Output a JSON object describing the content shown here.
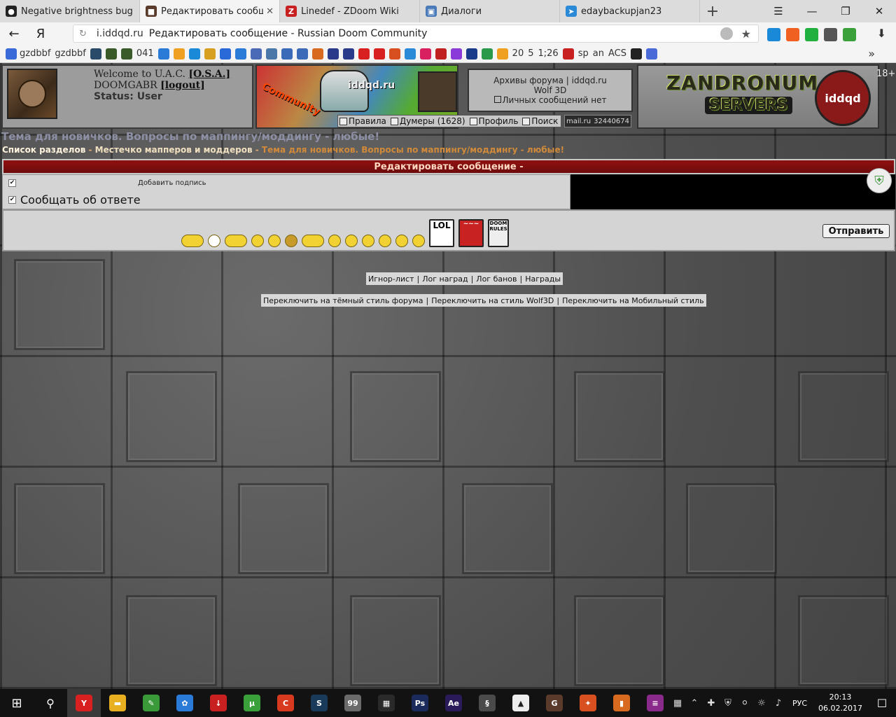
{
  "browser": {
    "tabs": [
      {
        "label": "Negative brightness bug (UD",
        "icon": "github-icon",
        "color": "#222222",
        "glyph": "●",
        "active": false,
        "close": ""
      },
      {
        "label": "Редактировать сообщение",
        "icon": "iddqd-icon",
        "color": "#5a3a2a",
        "glyph": "■",
        "active": true,
        "close": "✕"
      },
      {
        "label": "Linedef - ZDoom Wiki",
        "icon": "zdoom-icon",
        "color": "#c82020",
        "glyph": "Z",
        "active": false,
        "close": ""
      },
      {
        "label": "Диалоги",
        "icon": "messages-icon",
        "color": "#4a7ab8",
        "glyph": "▣",
        "active": false,
        "close": ""
      },
      {
        "label": "edaybackupjan23",
        "icon": "telegram-icon",
        "color": "#2a8ad8",
        "glyph": "➤",
        "active": false,
        "close": ""
      }
    ],
    "new_tab": "+",
    "window_controls": {
      "menu": "☰",
      "minimize": "—",
      "maximize": "❐",
      "close": "✕"
    },
    "back": "←",
    "yandex": "Я",
    "reload": "↻",
    "url_domain": "i.iddqd.ru",
    "url_title": "Редактировать сообщение - Russian Doom Community",
    "star": "★",
    "ext_colors": [
      "#1a8ad8",
      "#f06020",
      "#20b040",
      "#555555",
      "#3aa03a"
    ],
    "download": "⬇",
    "bookmarks": [
      {
        "label": "gzdbbf",
        "color": "#3a6ad8"
      },
      {
        "label": "gzdbbf",
        "color": ""
      },
      {
        "label": "",
        "color": "#2a4a6a"
      },
      {
        "label": "",
        "color": "#3a5a2a"
      },
      {
        "label": "",
        "color": "#3a5a2a"
      },
      {
        "label": "041",
        "color": ""
      },
      {
        "label": "",
        "color": "#2a7ad8"
      },
      {
        "label": "",
        "color": "#f0a020"
      },
      {
        "label": "",
        "color": "#1a8ad8"
      },
      {
        "label": "",
        "color": "#d8a020"
      },
      {
        "label": "",
        "color": "#2a6ad8"
      },
      {
        "label": "",
        "color": "#2a7ad8"
      },
      {
        "label": "",
        "color": "#4a6ab8"
      },
      {
        "label": "",
        "color": "#4a76a8"
      },
      {
        "label": "",
        "color": "#3a6ab8"
      },
      {
        "label": "",
        "color": "#3a6ab8"
      },
      {
        "label": "",
        "color": "#d86a20"
      },
      {
        "label": "",
        "color": "#2a3a8a"
      },
      {
        "label": "",
        "color": "#2a3a8a"
      },
      {
        "label": "",
        "color": "#d82020"
      },
      {
        "label": "",
        "color": "#d82020"
      },
      {
        "label": "",
        "color": "#d85020"
      },
      {
        "label": "",
        "color": "#2a8ad8"
      },
      {
        "label": "",
        "color": "#d82060"
      },
      {
        "label": "",
        "color": "#c02020"
      },
      {
        "label": "",
        "color": "#8a3ad8"
      },
      {
        "label": "",
        "color": "#1a3a8a"
      },
      {
        "label": "",
        "color": "#2a9a4a"
      },
      {
        "label": "",
        "color": "#f0a020"
      },
      {
        "label": "20",
        "color": ""
      },
      {
        "label": "5",
        "color": ""
      },
      {
        "label": "1;26",
        "color": ""
      },
      {
        "label": "",
        "color": "#c82020"
      },
      {
        "label": "sp",
        "color": ""
      },
      {
        "label": "an",
        "color": ""
      },
      {
        "label": "ACS",
        "color": ""
      },
      {
        "label": "",
        "color": "#222222"
      },
      {
        "label": "",
        "color": "#4a6ad8"
      }
    ],
    "bookmarks_more": "»"
  },
  "forum": {
    "welcome": "Welcome to U.A.C.",
    "osa": "[O.S.A.]",
    "username": "DOOMGABR",
    "logout": "[logout]",
    "status": "Status: User",
    "banner_community": "Community",
    "banner_site": "iddqd.ru",
    "nav": [
      {
        "label": "Правила",
        "icon": "rules-icon"
      },
      {
        "label": "Думеры (1628)",
        "icon": "users-icon"
      },
      {
        "label": "Профиль",
        "icon": "profile-icon"
      },
      {
        "label": "Поиск",
        "icon": "search-icon"
      }
    ],
    "archive_line1": "Архивы форума | iddqd.ru",
    "archive_line2": "Wolf 3D",
    "private_msgs": "Личных сообщений нет",
    "counter_left": "mail.ru",
    "counter_right": "32440674",
    "zand_title": "ZANDRONUM",
    "zand_servers": "SERVERS",
    "zand_badge": "iddqd",
    "age": "18+",
    "topic_title": "Тема для новичков. Вопросы по маппингу/моддингу - любые!",
    "breadcrumb": {
      "root": "Список разделов",
      "sep": " - ",
      "section": "Местечко мапперов и моддеров",
      "topic": "Тема для новичков. Вопросы по маппингу/моддингу - любые!"
    },
    "edit_header": "Редактировать сообщение -",
    "add_signature": "Добавить подпись",
    "notify_reply": "Сообщать об ответе",
    "smiley_signs": {
      "lol": "LOL",
      "red": "~~~",
      "doom": "DOOM RULES"
    },
    "send_button": "Отправить",
    "footer_links1": [
      "Игнор-лист",
      "Лог наград",
      "Лог банов",
      "Награды"
    ],
    "footer_links2": [
      "Переключить на тёмный стиль форума",
      "Переключить на стиль Wolf3D",
      "Переключить на Мобильный стиль"
    ],
    "link_sep": "|"
  },
  "taskbar": {
    "start": "⊞",
    "search": "⚲",
    "apps": [
      {
        "name": "yandex-browser-app",
        "color": "#d82020",
        "glyph": "Y",
        "active": true
      },
      {
        "name": "file-explorer-app",
        "color": "#e8b020",
        "glyph": "▬",
        "active": false
      },
      {
        "name": "notepad-app",
        "color": "#3a9a3a",
        "glyph": "✎",
        "active": false
      },
      {
        "name": "paint-app",
        "color": "#2a7ad8",
        "glyph": "✿",
        "active": false
      },
      {
        "name": "download-app",
        "color": "#c82020",
        "glyph": "↓",
        "active": false
      },
      {
        "name": "torrent-app",
        "color": "#3aa03a",
        "glyph": "μ",
        "active": false
      },
      {
        "name": "ccleaner-app",
        "color": "#d83a20",
        "glyph": "C",
        "active": false
      },
      {
        "name": "steam-app",
        "color": "#1a3a5a",
        "glyph": "S",
        "active": false
      },
      {
        "name": "editor-app",
        "color": "#6a6a6a",
        "glyph": "99",
        "active": false
      },
      {
        "name": "video-app",
        "color": "#2a2a2a",
        "glyph": "▦",
        "active": false
      },
      {
        "name": "photoshop-app",
        "color": "#1a2a5a",
        "glyph": "Ps",
        "active": false
      },
      {
        "name": "after-effects-app",
        "color": "#2a1a5a",
        "glyph": "Ae",
        "active": false
      },
      {
        "name": "slade-app",
        "color": "#4a4a4a",
        "glyph": "§",
        "active": false
      },
      {
        "name": "photos-app",
        "color": "#eeeeee",
        "glyph": "▲",
        "active": false
      },
      {
        "name": "gzdb-app",
        "color": "#5a3a2a",
        "glyph": "G",
        "active": false
      },
      {
        "name": "tool-app",
        "color": "#d85020",
        "glyph": "✦",
        "active": false
      },
      {
        "name": "office-app",
        "color": "#d86a20",
        "glyph": "▮",
        "active": false
      },
      {
        "name": "archiver-app",
        "color": "#8a2a8a",
        "glyph": "≡",
        "active": false
      }
    ],
    "tray_icons": [
      "▦",
      "⌃",
      "✚",
      "⛨",
      "⚪",
      "☼",
      "♪"
    ],
    "lang": "РУС",
    "time": "20:13",
    "date": "06.02.2017",
    "notifications": "☐"
  }
}
